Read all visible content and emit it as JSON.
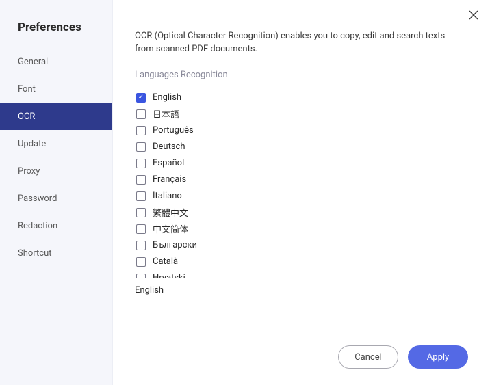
{
  "sidebar": {
    "title": "Preferences",
    "items": [
      {
        "label": "General",
        "key": "general"
      },
      {
        "label": "Font",
        "key": "font"
      },
      {
        "label": "OCR",
        "key": "ocr"
      },
      {
        "label": "Update",
        "key": "update"
      },
      {
        "label": "Proxy",
        "key": "proxy"
      },
      {
        "label": "Password",
        "key": "password"
      },
      {
        "label": "Redaction",
        "key": "redaction"
      },
      {
        "label": "Shortcut",
        "key": "shortcut"
      }
    ],
    "active_key": "ocr"
  },
  "main": {
    "description": "OCR (Optical Character Recognition) enables you to copy, edit and search texts from scanned PDF documents.",
    "section_label": "Languages Recognition",
    "selected_summary": "English"
  },
  "languages": [
    {
      "label": "English",
      "checked": true
    },
    {
      "label": "日本語",
      "checked": false
    },
    {
      "label": "Português",
      "checked": false
    },
    {
      "label": "Deutsch",
      "checked": false
    },
    {
      "label": "Español",
      "checked": false
    },
    {
      "label": "Français",
      "checked": false
    },
    {
      "label": "Italiano",
      "checked": false
    },
    {
      "label": "繁體中文",
      "checked": false
    },
    {
      "label": "中文简体",
      "checked": false
    },
    {
      "label": "Български",
      "checked": false
    },
    {
      "label": "Català",
      "checked": false
    },
    {
      "label": "Hrvatski",
      "checked": false
    }
  ],
  "footer": {
    "cancel_label": "Cancel",
    "apply_label": "Apply"
  }
}
